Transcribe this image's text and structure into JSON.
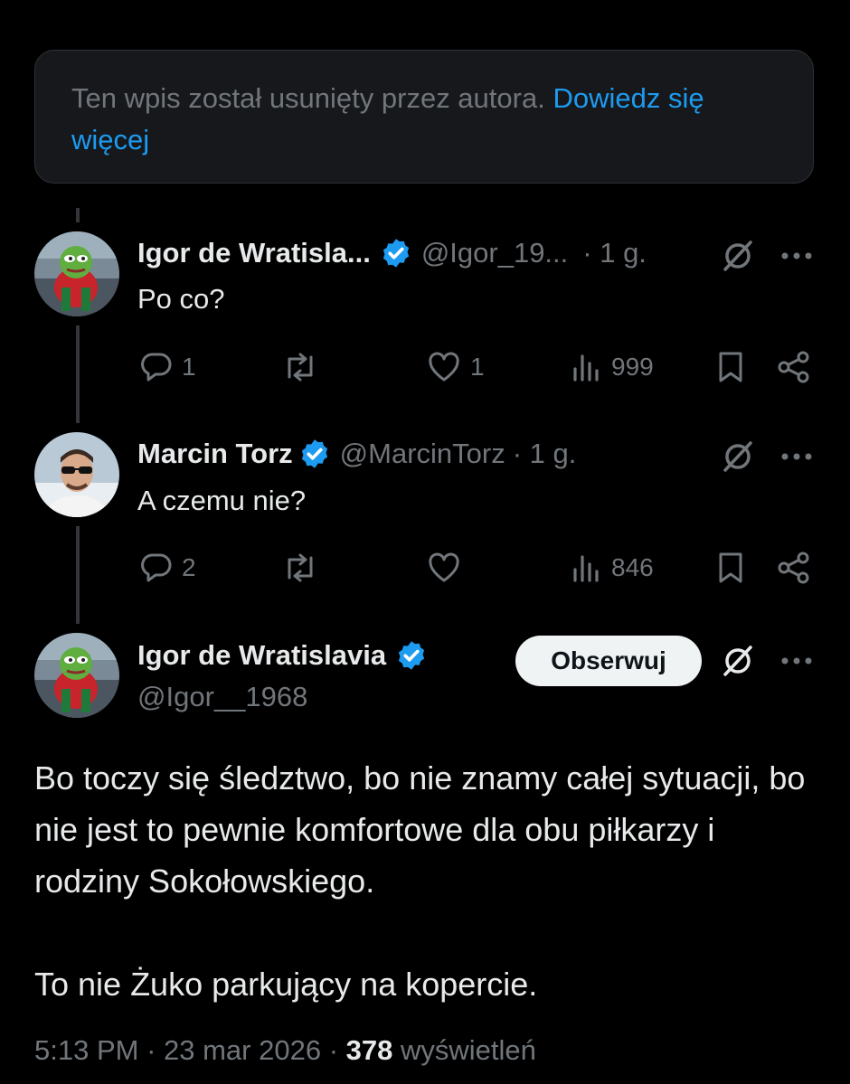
{
  "deleted_notice": {
    "text": "Ten wpis został usunięty przez autora.",
    "link": "Dowiedz się więcej"
  },
  "reply1": {
    "name": "Igor de Wratisla...",
    "handle": "@Igor_19...",
    "time": "· 1 g.",
    "text": "Po co?",
    "replies": "1",
    "reposts": "",
    "likes": "1",
    "views": "999"
  },
  "reply2": {
    "name": "Marcin Torz",
    "handle": "@MarcinTorz",
    "time": "· 1 g.",
    "text": "A czemu nie?",
    "replies": "2",
    "reposts": "",
    "likes": "",
    "views": "846"
  },
  "main_post": {
    "name": "Igor de Wratislavia",
    "handle": "@Igor__1968",
    "follow_label": "Obserwuj",
    "text": "Bo toczy się śledztwo, bo nie znamy całej sytuacji, bo nie jest to pewnie komfortowe dla obu piłkarzy i rodziny Sokołowskiego.\n\nTo nie Żuko parkujący na kopercie.",
    "time": "5:13 PM",
    "date": "23 mar 2026",
    "views_count": "378",
    "views_label": "wyświetleń"
  },
  "colors": {
    "background": "#000000",
    "accent": "#1d9bf0",
    "muted": "#71767b",
    "text": "#e7e9ea"
  }
}
